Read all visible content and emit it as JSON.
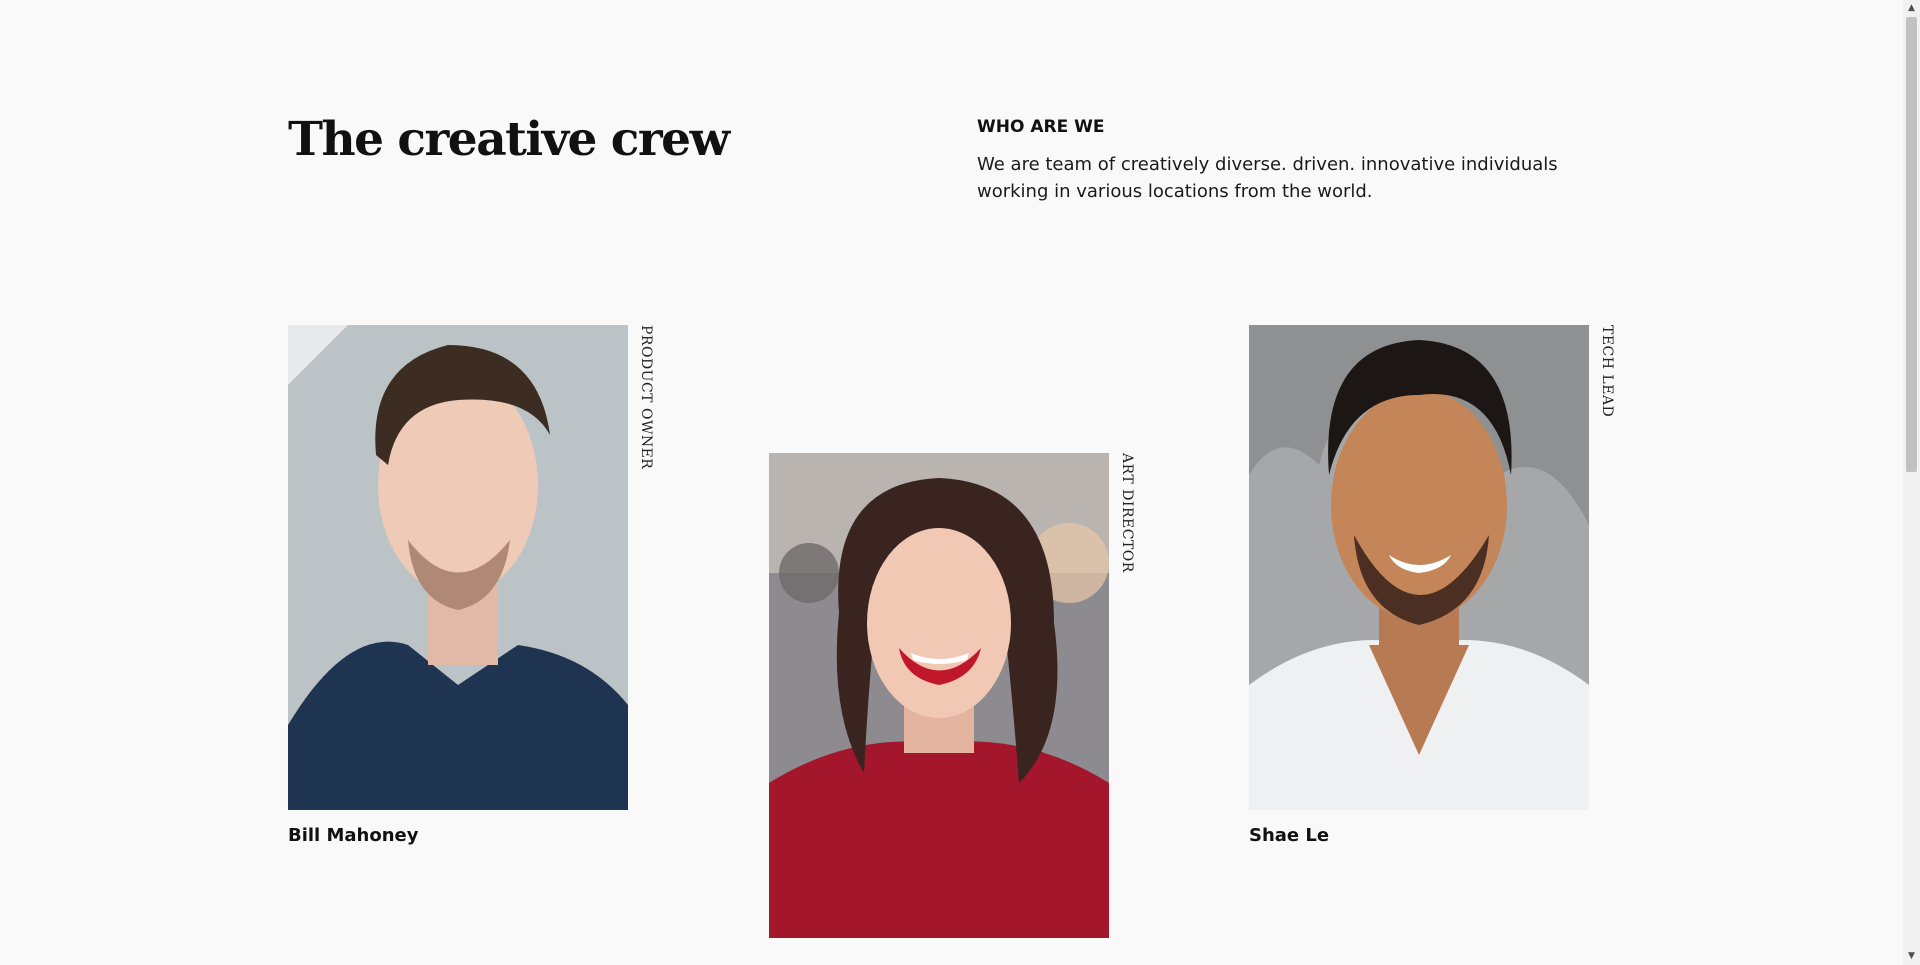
{
  "header": {
    "title": "The creative crew",
    "who_heading": "WHO ARE WE",
    "who_text": "We are team of creatively diverse. driven. innovative individuals working in various locations from the world."
  },
  "team": [
    {
      "name": "Bill Mahoney",
      "role": "PRODUCT OWNER"
    },
    {
      "name": "",
      "role": "ART DIRECTOR"
    },
    {
      "name": "Shae Le",
      "role": "TECH LEAD"
    }
  ],
  "scrollbar": {
    "up_icon": "chevron-up-icon",
    "down_icon": "chevron-down-icon"
  }
}
